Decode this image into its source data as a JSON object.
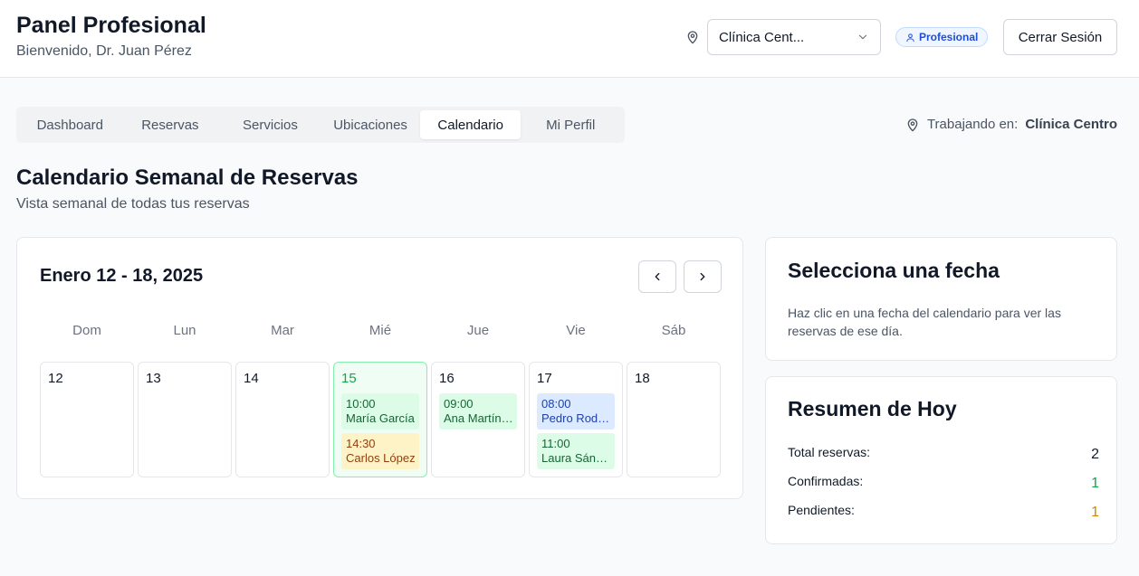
{
  "header": {
    "title": "Panel Profesional",
    "subtitle": "Bienvenido, Dr. Juan Pérez",
    "location_select": "Clínica Cent...",
    "role_badge": "Profesional",
    "logout_label": "Cerrar Sesión"
  },
  "tabs": [
    {
      "label": "Dashboard",
      "active": false
    },
    {
      "label": "Reservas",
      "active": false
    },
    {
      "label": "Servicios",
      "active": false
    },
    {
      "label": "Ubicaciones",
      "active": false
    },
    {
      "label": "Calendario",
      "active": true
    },
    {
      "label": "Mi Perfil",
      "active": false
    }
  ],
  "working": {
    "prefix": "Trabajando en:",
    "location": "Clínica Centro"
  },
  "page": {
    "title": "Calendario Semanal de Reservas",
    "subtitle": "Vista semanal de todas tus reservas"
  },
  "calendar": {
    "range": "Enero 12 - 18, 2025",
    "weekdays": [
      "Dom",
      "Lun",
      "Mar",
      "Mié",
      "Jue",
      "Vie",
      "Sáb"
    ],
    "days": [
      {
        "num": "12",
        "today": false,
        "appointments": []
      },
      {
        "num": "13",
        "today": false,
        "appointments": []
      },
      {
        "num": "14",
        "today": false,
        "appointments": []
      },
      {
        "num": "15",
        "today": true,
        "appointments": [
          {
            "time": "10:00",
            "name": "María García",
            "status": "green"
          },
          {
            "time": "14:30",
            "name": "Carlos López",
            "status": "yellow"
          }
        ]
      },
      {
        "num": "16",
        "today": false,
        "appointments": [
          {
            "time": "09:00",
            "name": "Ana Martínez",
            "status": "green"
          }
        ]
      },
      {
        "num": "17",
        "today": false,
        "appointments": [
          {
            "time": "08:00",
            "name": "Pedro Rodrí...",
            "status": "blue"
          },
          {
            "time": "11:00",
            "name": "Laura Sánc...",
            "status": "green"
          }
        ]
      },
      {
        "num": "18",
        "today": false,
        "appointments": []
      }
    ]
  },
  "select_date": {
    "title": "Selecciona una fecha",
    "text": "Haz clic en una fecha del calendario para ver las reservas de ese día."
  },
  "summary": {
    "title": "Resumen de Hoy",
    "total_label": "Total reservas:",
    "total_value": "2",
    "confirmed_label": "Confirmadas:",
    "confirmed_value": "1",
    "pending_label": "Pendientes:",
    "pending_value": "1"
  },
  "colors": {
    "confirmed": "#16a34a",
    "pending": "#ca8a04",
    "accent": "#1d4ed8"
  }
}
